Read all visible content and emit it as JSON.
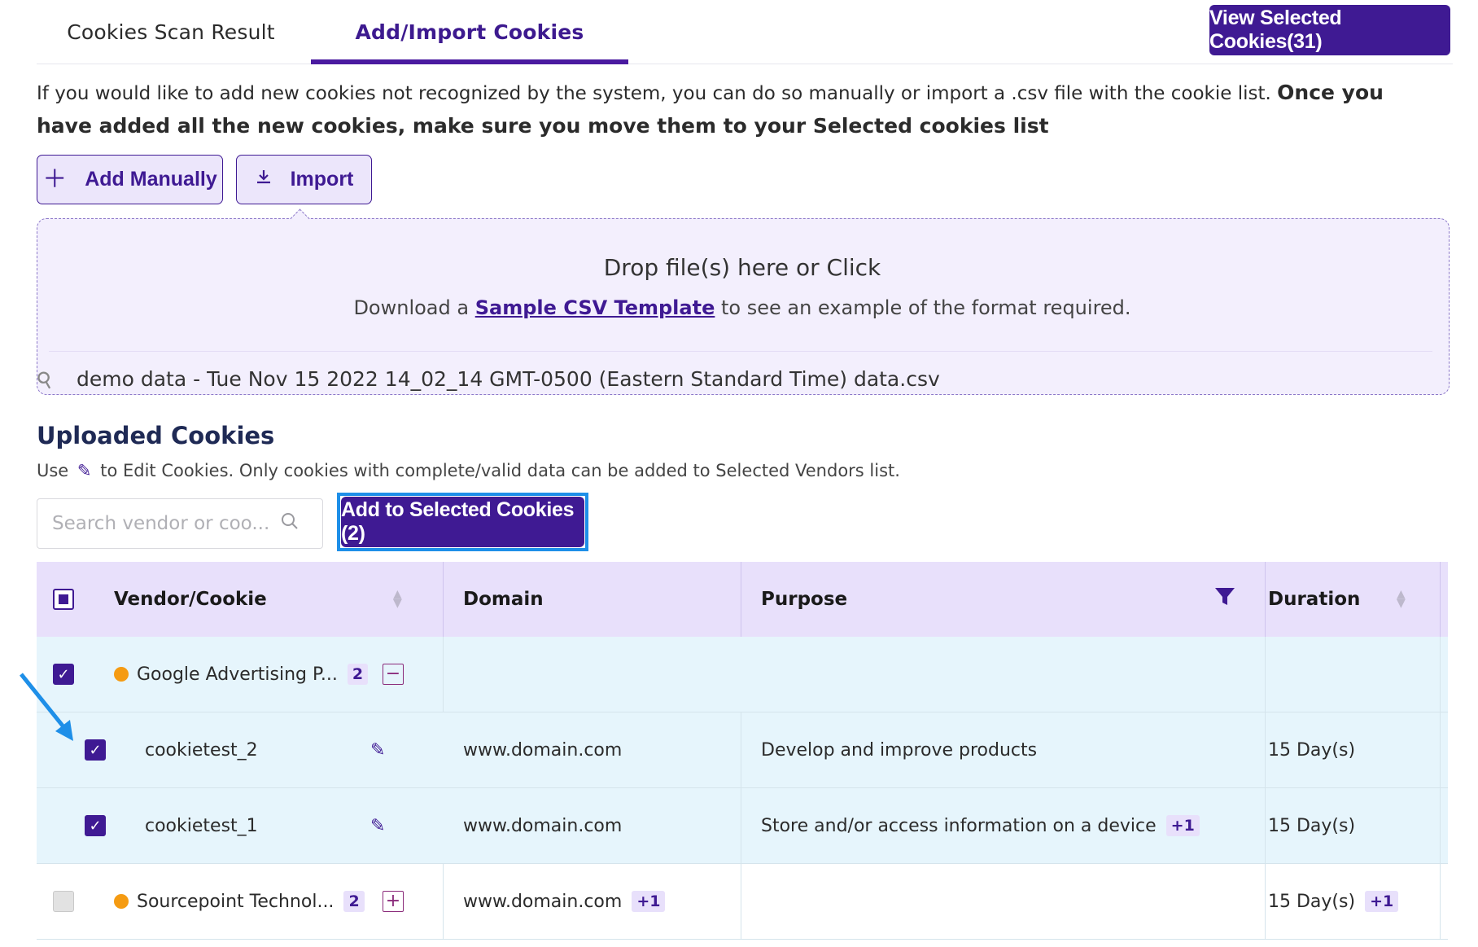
{
  "tabs": [
    {
      "label": "Cookies Scan Result"
    },
    {
      "label": "Add/Import Cookies"
    }
  ],
  "view_selected_label": "View Selected Cookies(31)",
  "intro": {
    "text": "If you would like to add new cookies not recognized by the system, you can do so manually or import a .csv file with the cookie list.",
    "bold": "Once you have added all the new cookies, make sure you move them to your Selected cookies list"
  },
  "actions": {
    "add_manually": "Add Manually",
    "import": "Import"
  },
  "dropzone": {
    "title": "Drop file(s) here or Click",
    "sub_before": "Download a",
    "link": "Sample CSV Template",
    "sub_after": "to see an example of the format required.",
    "file_name": "demo data - Tue Nov 15 2022 14_02_14 GMT-0500 (Eastern Standard Time) data.csv"
  },
  "uploaded": {
    "title": "Uploaded Cookies",
    "sub_before": "Use",
    "sub_after": "to Edit Cookies. Only cookies with complete/valid data can be added to Selected Vendors list.",
    "search_placeholder": "Search vendor or coo...",
    "add_button": "Add to Selected Cookies (2)"
  },
  "table": {
    "headers": {
      "vendor": "Vendor/Cookie",
      "domain": "Domain",
      "purpose": "Purpose",
      "duration": "Duration"
    },
    "rows": [
      {
        "type": "vendor",
        "name": "Google Advertising P...",
        "count": "2",
        "checked": true,
        "expanded": true,
        "domain": "",
        "domain_extra": "",
        "purpose": "",
        "purpose_extra": "",
        "duration": "",
        "duration_extra": ""
      },
      {
        "type": "cookie",
        "name": "cookietest_2",
        "checked": true,
        "domain": "www.domain.com",
        "purpose": "Develop and improve products",
        "purpose_extra": "",
        "duration": "15 Day(s)"
      },
      {
        "type": "cookie",
        "name": "cookietest_1",
        "checked": true,
        "domain": "www.domain.com",
        "purpose": "Store and/or access information on a device",
        "purpose_extra": "+1",
        "duration": "15 Day(s)"
      },
      {
        "type": "vendor",
        "name": "Sourcepoint Technol...",
        "count": "2",
        "checked": false,
        "expanded": false,
        "domain": "www.domain.com",
        "domain_extra": "+1",
        "purpose": "",
        "purpose_extra": "",
        "duration": "15 Day(s)",
        "duration_extra": "+1"
      }
    ]
  },
  "colors": {
    "primary": "#3f1a93",
    "header_bg": "#e8e0fb",
    "selected_row": "#e6f5fc",
    "highlight": "#1e8fe8",
    "vendor_dot": "#f59b12"
  }
}
